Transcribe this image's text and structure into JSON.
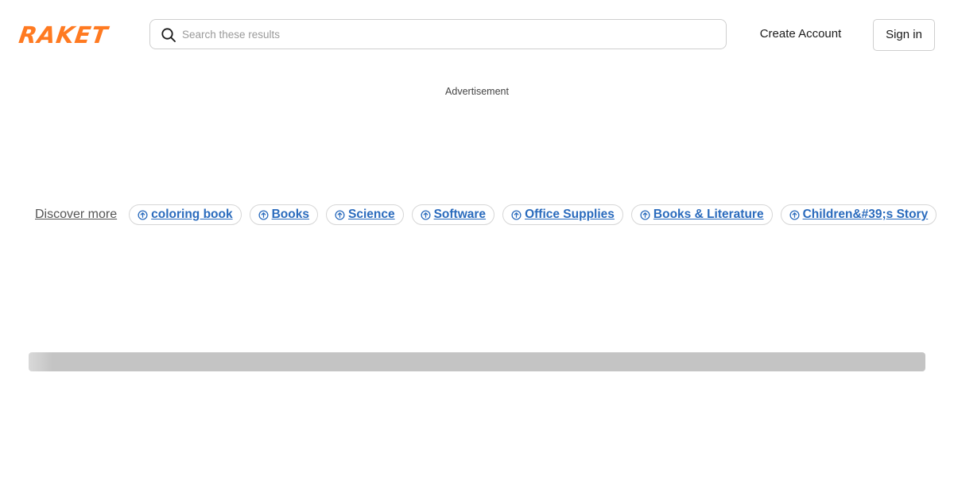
{
  "header": {
    "logo_text": "RAKET",
    "search": {
      "placeholder": "Search these results",
      "value": ""
    },
    "create_account_label": "Create Account",
    "sign_in_label": "Sign in"
  },
  "ad": {
    "label": "Advertisement"
  },
  "discover": {
    "label": "Discover more",
    "chips": [
      {
        "label": "coloring book",
        "icon": "circle-arrow-up-icon"
      },
      {
        "label": "Books",
        "icon": "circle-arrow-up-icon"
      },
      {
        "label": "Science",
        "icon": "circle-arrow-up-icon"
      },
      {
        "label": "Software",
        "icon": "circle-arrow-up-icon"
      },
      {
        "label": "Office Supplies",
        "icon": "circle-arrow-up-icon"
      },
      {
        "label": "Books & Literature",
        "icon": "circle-arrow-up-icon"
      },
      {
        "label": "Children&#39;s Story",
        "icon": "circle-arrow-up-icon"
      }
    ]
  },
  "colors": {
    "brand": "#ff7a21",
    "link": "#2a6bbd",
    "placeholder_bar": "#c4c4c4"
  }
}
